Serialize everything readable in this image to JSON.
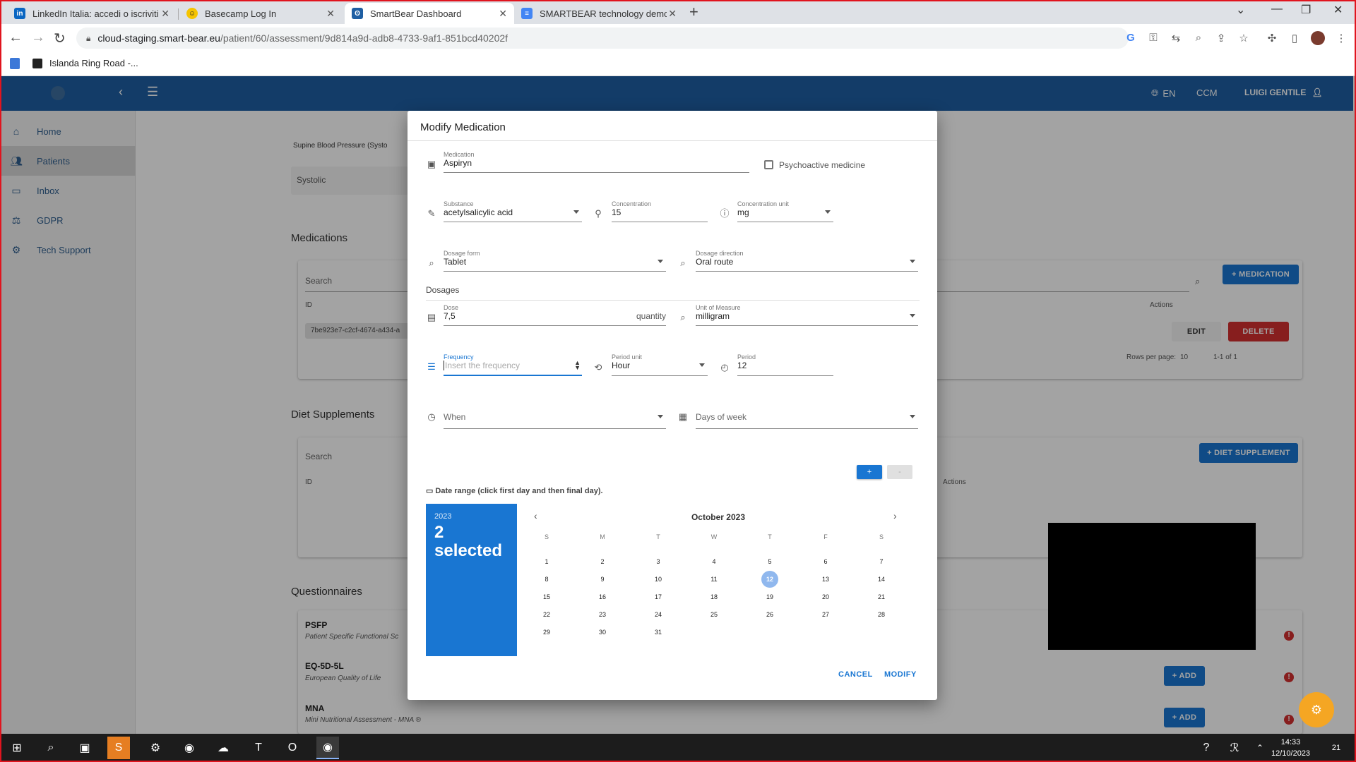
{
  "browser": {
    "tabs": [
      {
        "label": "LinkedIn Italia: accedi o iscriviti",
        "icon": "linkedin-icon",
        "color": "#0a66c2"
      },
      {
        "label": "Basecamp Log In",
        "icon": "basecamp-icon",
        "color": "#f5c400"
      },
      {
        "label": "SmartBear Dashboard",
        "icon": "smartbear-icon",
        "color": "#1f5fa3"
      },
      {
        "label": "SMARTBEAR technology demon",
        "icon": "docs-icon",
        "color": "#4285f4"
      }
    ],
    "url_host": "cloud-staging.smart-bear.eu",
    "url_path": "/patient/60/assessment/9d814a9d-adb8-4733-9af1-851bcd40202f",
    "bookmark": "Islanda Ring Road -..."
  },
  "appbar": {
    "lang": "EN",
    "ccm": "CCM",
    "user": "LUIGI GENTILE"
  },
  "sidebar": {
    "items": [
      {
        "label": "Home",
        "icon": "home-icon"
      },
      {
        "label": "Patients",
        "icon": "patients-icon"
      },
      {
        "label": "Inbox",
        "icon": "inbox-icon"
      },
      {
        "label": "GDPR",
        "icon": "gavel-icon"
      },
      {
        "label": "Tech Support",
        "icon": "support-icon"
      }
    ]
  },
  "background": {
    "bp_label": "Supine Blood Pressure (Systo",
    "systolic": "Systolic",
    "medications_title": "Medications",
    "search": "Search",
    "id_header": "ID",
    "actions_header": "Actions",
    "med_row_id": "7be923e7-c2cf-4674-a434-a",
    "add_medication": "+ MEDICATION",
    "edit": "EDIT",
    "delete": "DELETE",
    "rows_per_page": "Rows per page:",
    "rows_value": "10",
    "range": "1-1 of 1",
    "diet_title": "Diet Supplements",
    "add_diet": "+ DIET SUPPLEMENT",
    "questionnaires_title": "Questionnaires",
    "questionnaires": [
      {
        "name": "PSFP",
        "desc": "Patient Specific Functional Sc"
      },
      {
        "name": "EQ-5D-5L",
        "desc": "European Quality of Life"
      },
      {
        "name": "MNA",
        "desc": "Mini Nutritional Assessment - MNA ®"
      }
    ],
    "add": "+ ADD"
  },
  "dialog": {
    "title": "Modify Medication",
    "medication_label": "Medication",
    "medication_value": "Aspiryn",
    "psychoactive_label": "Psychoactive medicine",
    "substance_label": "Substance",
    "substance_value": "acetylsalicylic acid",
    "concentration_label": "Concentration",
    "concentration_value": "15",
    "conc_unit_label": "Concentration unit",
    "conc_unit_value": "mg",
    "dosage_form_label": "Dosage form",
    "dosage_form_value": "Tablet",
    "dosage_direction_label": "Dosage direction",
    "dosage_direction_value": "Oral route",
    "dosages_title": "Dosages",
    "dose_label": "Dose",
    "dose_value": "7,5",
    "dose_suffix": "quantity",
    "uom_label": "Unit of Measure",
    "uom_value": "milligram",
    "frequency_label": "Frequency",
    "frequency_placeholder": "Insert the frequency",
    "period_unit_label": "Period unit",
    "period_unit_value": "Hour",
    "period_label": "Period",
    "period_value": "12",
    "when_placeholder": "When",
    "days_placeholder": "Days of week",
    "plus": "+",
    "minus": "-",
    "date_range_label": "Date range (click first day and then final day).",
    "calendar": {
      "year": "2023",
      "selected_line1": "2",
      "selected_line2": "selected",
      "month": "October 2023",
      "weekdays": [
        "S",
        "M",
        "T",
        "W",
        "T",
        "F",
        "S"
      ],
      "days": [
        "1",
        "2",
        "3",
        "4",
        "5",
        "6",
        "7",
        "8",
        "9",
        "10",
        "11",
        "12",
        "13",
        "14",
        "15",
        "16",
        "17",
        "18",
        "19",
        "20",
        "21",
        "22",
        "23",
        "24",
        "25",
        "26",
        "27",
        "28",
        "29",
        "30",
        "31"
      ],
      "today": "12"
    },
    "cancel": "CANCEL",
    "modify": "MODIFY"
  },
  "taskbar": {
    "time": "14:33",
    "date": "12/10/2023",
    "notif": "21"
  }
}
